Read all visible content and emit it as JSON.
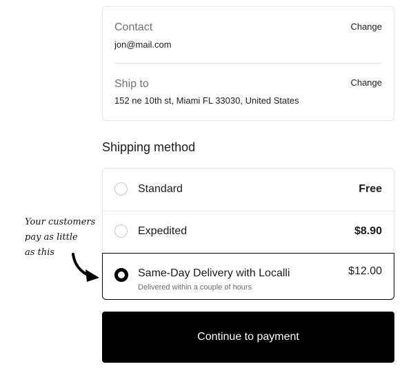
{
  "contact": {
    "label": "Contact",
    "value": "jon@mail.com",
    "change_label": "Change"
  },
  "ship_to": {
    "label": "Ship to",
    "value": "152 ne 10th st, Miami FL 33030, United States",
    "change_label": "Change"
  },
  "shipping_method": {
    "heading": "Shipping method",
    "options": [
      {
        "label": "Standard",
        "price": "Free",
        "selected": false
      },
      {
        "label": "Expedited",
        "price": "$8.90",
        "selected": false
      },
      {
        "label": "Same-Day Delivery with Localli",
        "sublabel": "Delivered within a couple of hours",
        "price": "$12.00",
        "selected": true
      }
    ]
  },
  "cta": {
    "label": "Continue to payment"
  },
  "annotation": {
    "lines": [
      "Your customers",
      "pay as little",
      "as this"
    ],
    "icon": "curved-arrow-icon"
  },
  "colors": {
    "primary": "#000000",
    "border": "#e3e3e3",
    "muted": "#707070"
  }
}
